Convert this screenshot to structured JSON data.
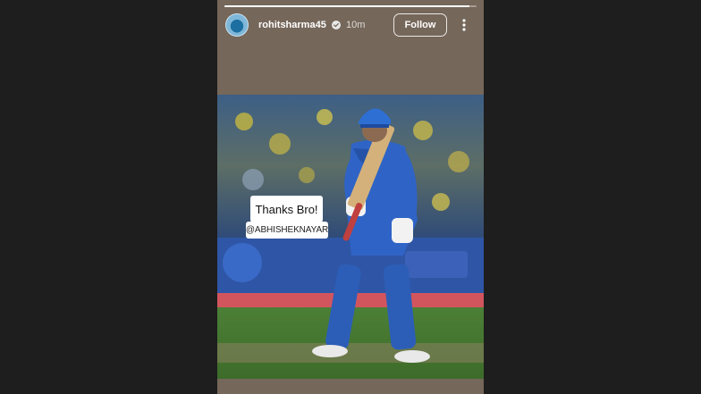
{
  "story": {
    "progress": 0.97,
    "username": "rohitsharma45",
    "verified": true,
    "time_ago": "10m",
    "follow_label": "Follow",
    "icons": {
      "avatar": "profile-avatar",
      "verified": "verified-badge-icon",
      "more": "more-vertical-icon"
    }
  },
  "stickers": {
    "text": "Thanks Bro!",
    "mention": "@ABHISHEKNAYAR"
  },
  "colors": {
    "page_background": "#1e1e1e",
    "story_background": "#75675a",
    "team_blue": "#2f5fb8",
    "pitch_green": "#4f8a3a"
  }
}
